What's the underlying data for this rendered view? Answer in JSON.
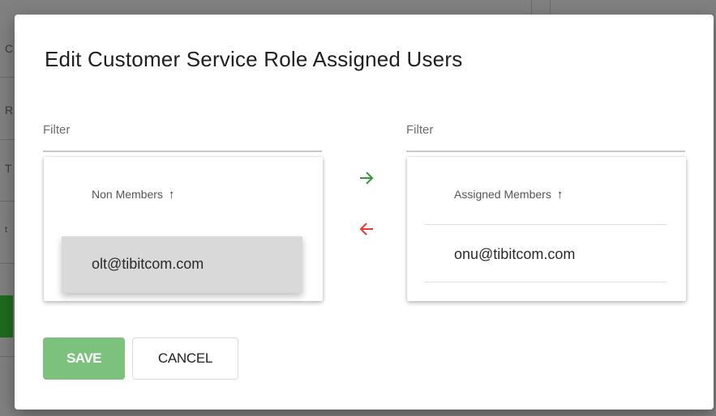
{
  "dialog": {
    "title": "Edit Customer Service Role Assigned Users"
  },
  "left": {
    "filter_placeholder": "Filter",
    "header": "Non Members",
    "sort_icon": "arrow-up-icon",
    "items": [
      "olt@tibitcom.com"
    ]
  },
  "right": {
    "filter_placeholder": "Filter",
    "header": "Assigned Members",
    "sort_icon": "arrow-up-icon",
    "items": [
      "onu@tibitcom.com"
    ]
  },
  "transfer": {
    "add_icon": "arrow-right-icon",
    "add_color": "#2e9a3a",
    "remove_icon": "arrow-left-icon",
    "remove_color": "#e53935"
  },
  "actions": {
    "save_label": "SAVE",
    "cancel_label": "CANCEL",
    "save_color": "#7cc17c"
  },
  "background": {
    "letters": [
      "C",
      "R",
      "T",
      "t",
      ">"
    ]
  }
}
